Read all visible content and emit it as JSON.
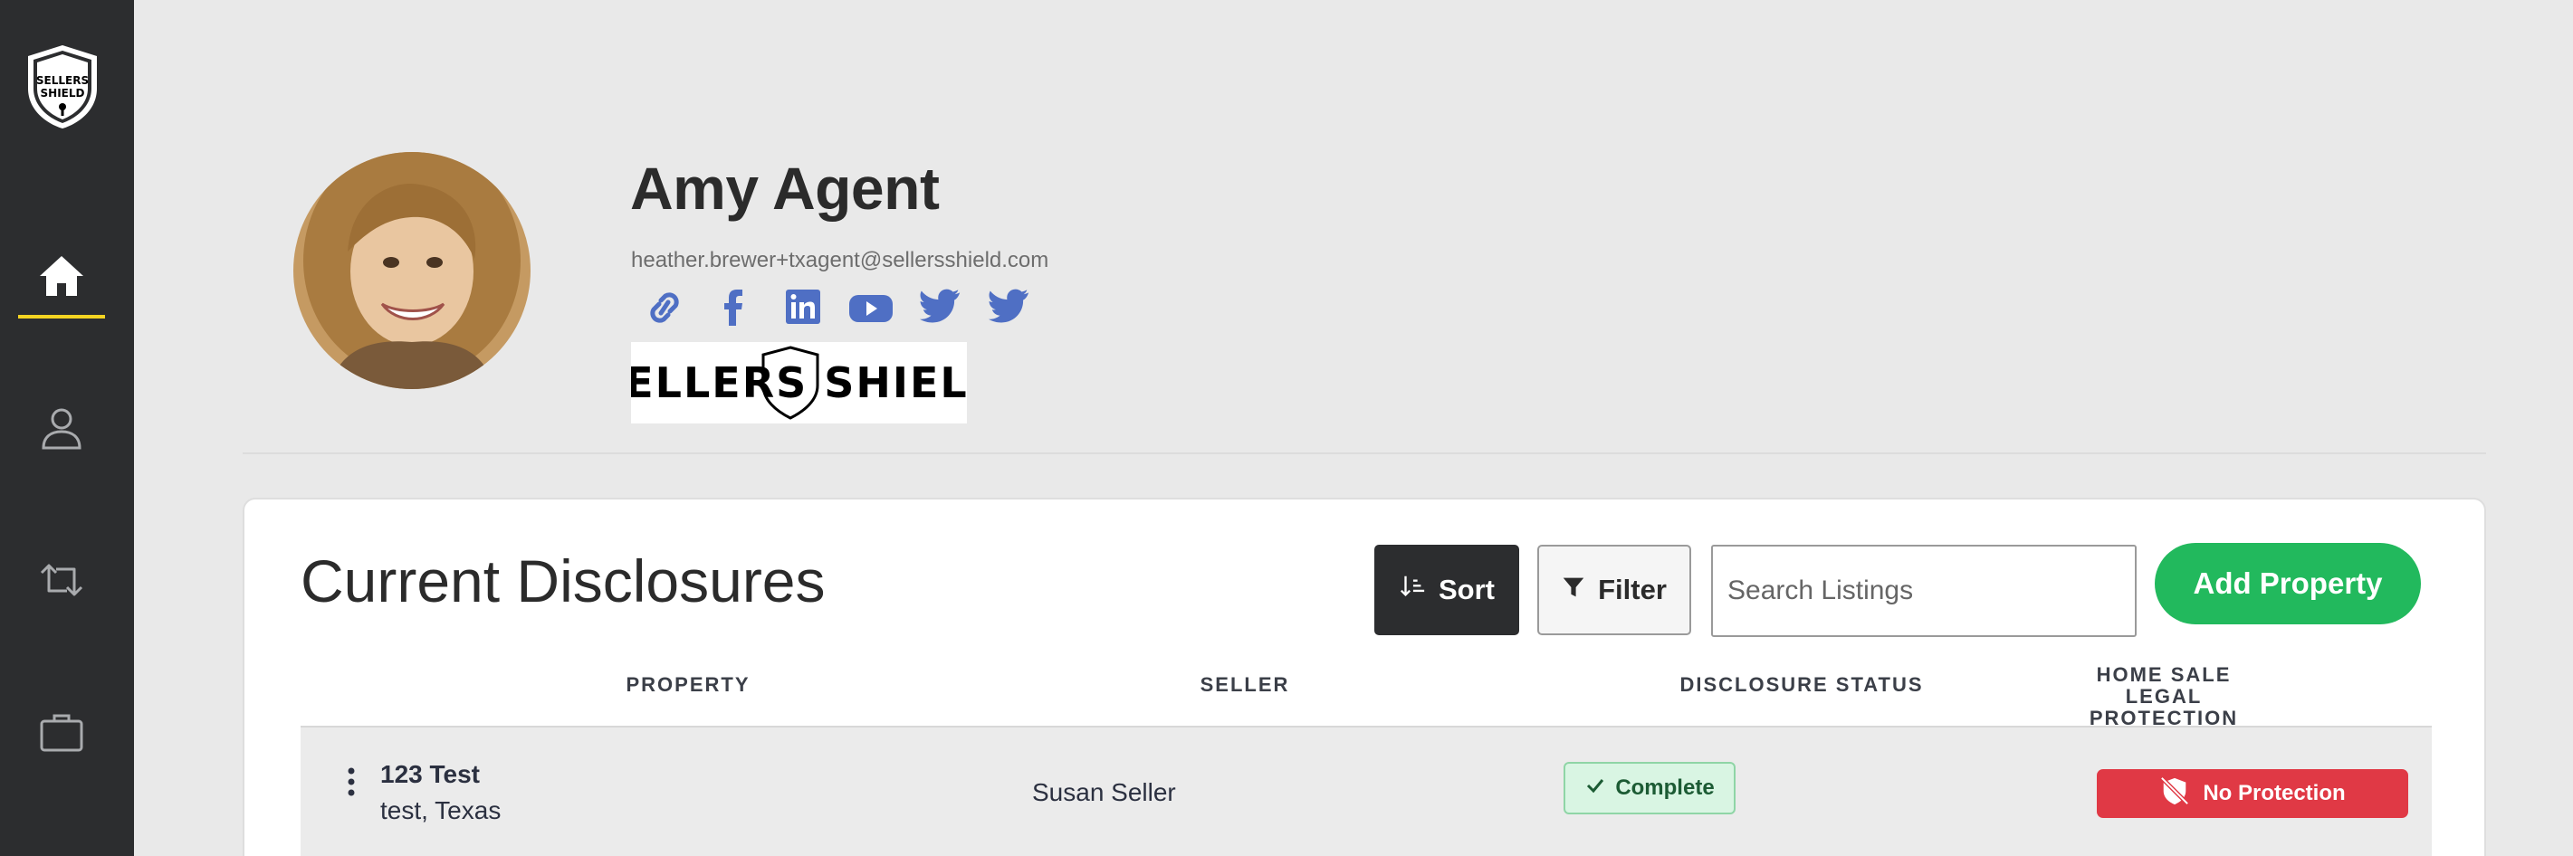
{
  "sidebar": {
    "logo_text": [
      "SELLERS",
      "SHIELD"
    ],
    "items": [
      {
        "name": "home",
        "icon": "home-icon",
        "active": true
      },
      {
        "name": "profile",
        "icon": "user-icon",
        "active": false
      },
      {
        "name": "transfer",
        "icon": "transfer-icon",
        "active": false
      },
      {
        "name": "briefcase",
        "icon": "briefcase-icon",
        "active": false
      }
    ],
    "active_indicator_color": "#f5d422"
  },
  "profile": {
    "name": "Amy Agent",
    "email": "heather.brewer+txagent@sellersshield.com",
    "social_icons": [
      "link-icon",
      "facebook-icon",
      "linkedin-icon",
      "youtube-icon",
      "twitter-icon",
      "twitter-icon"
    ],
    "social_color": "#4f6fc4",
    "brand_logo_text": "SELLERS SHIELD"
  },
  "disclosures": {
    "title": "Current Disclosures",
    "sort_label": "Sort",
    "filter_label": "Filter",
    "search_placeholder": "Search Listings",
    "add_label": "Add Property",
    "columns": {
      "property": "PROPERTY",
      "seller": "SELLER",
      "status": "DISCLOSURE STATUS",
      "protection": "HOME SALE LEGAL PROTECTION"
    },
    "rows": [
      {
        "title": "123 Test",
        "location": "test, Texas",
        "seller": "Susan Seller",
        "status": "Complete",
        "protection": "No Protection"
      }
    ]
  },
  "colors": {
    "sidebar_bg": "#2c2d2f",
    "page_bg": "#e9e9e9",
    "add_button": "#22b95d",
    "status_complete_bg": "#d9f5e3",
    "no_protection": "#e03945"
  }
}
